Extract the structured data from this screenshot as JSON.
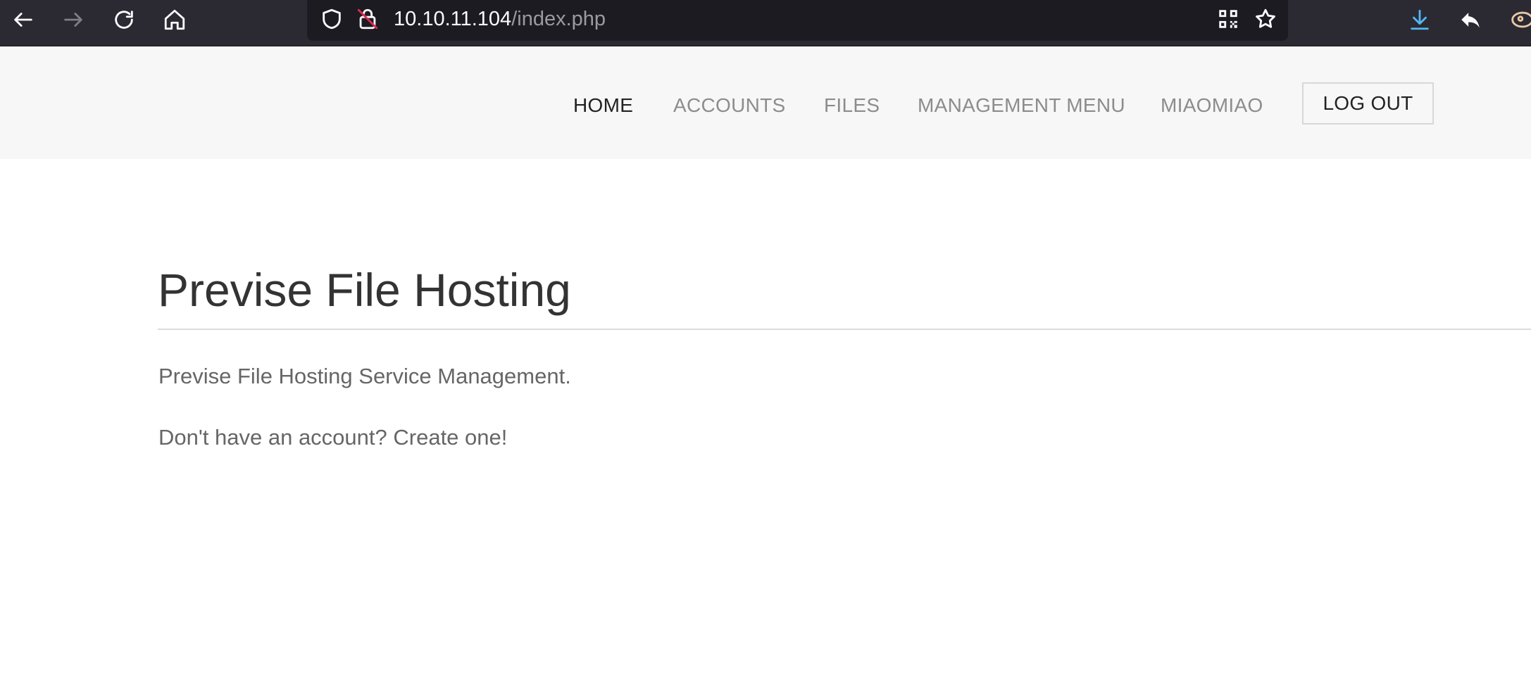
{
  "browser": {
    "url_host": "10.10.11.104",
    "url_path": "/index.php"
  },
  "navbar": {
    "items": [
      {
        "label": "HOME",
        "active": true
      },
      {
        "label": "ACCOUNTS",
        "active": false
      },
      {
        "label": "FILES",
        "active": false
      },
      {
        "label": "MANAGEMENT MENU",
        "active": false
      },
      {
        "label": "MIAOMIAO",
        "active": false
      }
    ],
    "logout_label": "LOG OUT"
  },
  "main": {
    "title": "Previse File Hosting",
    "description": "Previse File Hosting Service Management.",
    "signup_prompt": "Don't have an account? Create one!"
  },
  "icons": {
    "back": "back-arrow-icon",
    "forward": "forward-arrow-icon",
    "reload": "reload-icon",
    "home": "home-icon",
    "shield": "shield-icon",
    "insecure": "insecure-lock-icon",
    "qr": "qr-code-icon",
    "bookmark": "star-icon",
    "downloads": "download-icon",
    "reply": "reply-arrow-icon",
    "extension": "extension-icon"
  },
  "colors": {
    "toolbar_bg": "#2b2a33",
    "urlbar_bg": "#1c1b22",
    "navbar_bg": "#f7f7f7",
    "download_accent": "#54b8f0"
  }
}
